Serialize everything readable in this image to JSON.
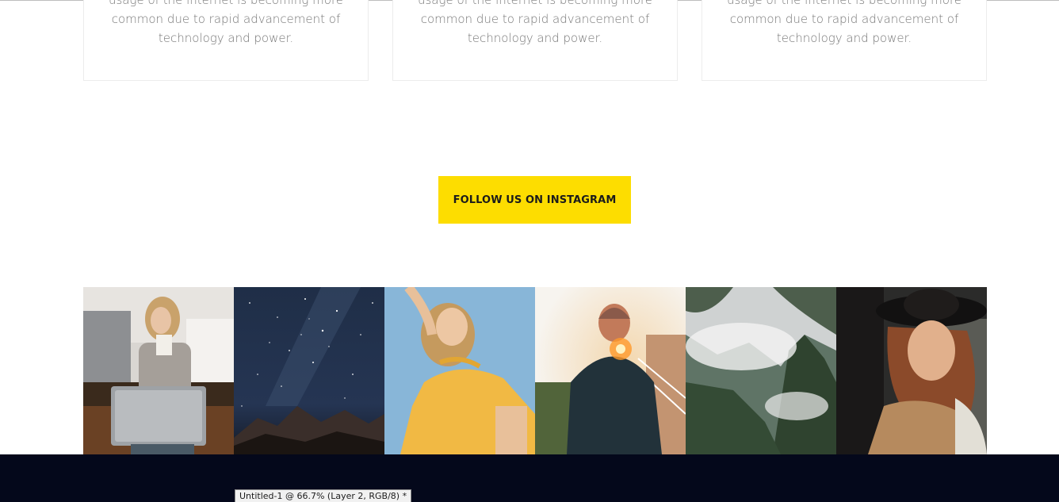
{
  "cards": [
    {
      "text": "usage of the internet is becoming more common due to rapid advancement of technology and power."
    },
    {
      "text": "usage of the internet is becoming more common due to rapid advancement of technology and power."
    },
    {
      "text": "usage of the internet is becoming more common due to rapid advancement of technology and power."
    }
  ],
  "cta": {
    "label": "FOLLOW US ON INSTAGRAM",
    "color": "#fddd00"
  },
  "gallery": {
    "items": [
      {
        "subject": "woman-with-laptop"
      },
      {
        "subject": "starry-night-sky"
      },
      {
        "subject": "woman-in-sunlight"
      },
      {
        "subject": "man-with-cap-back-view"
      },
      {
        "subject": "misty-mountains"
      },
      {
        "subject": "woman-with-hat"
      }
    ]
  },
  "footer": {
    "color": "#04081b"
  },
  "tooltip": {
    "text": "Untitled-1 @ 66.7% (Layer 2, RGB/8) *"
  }
}
